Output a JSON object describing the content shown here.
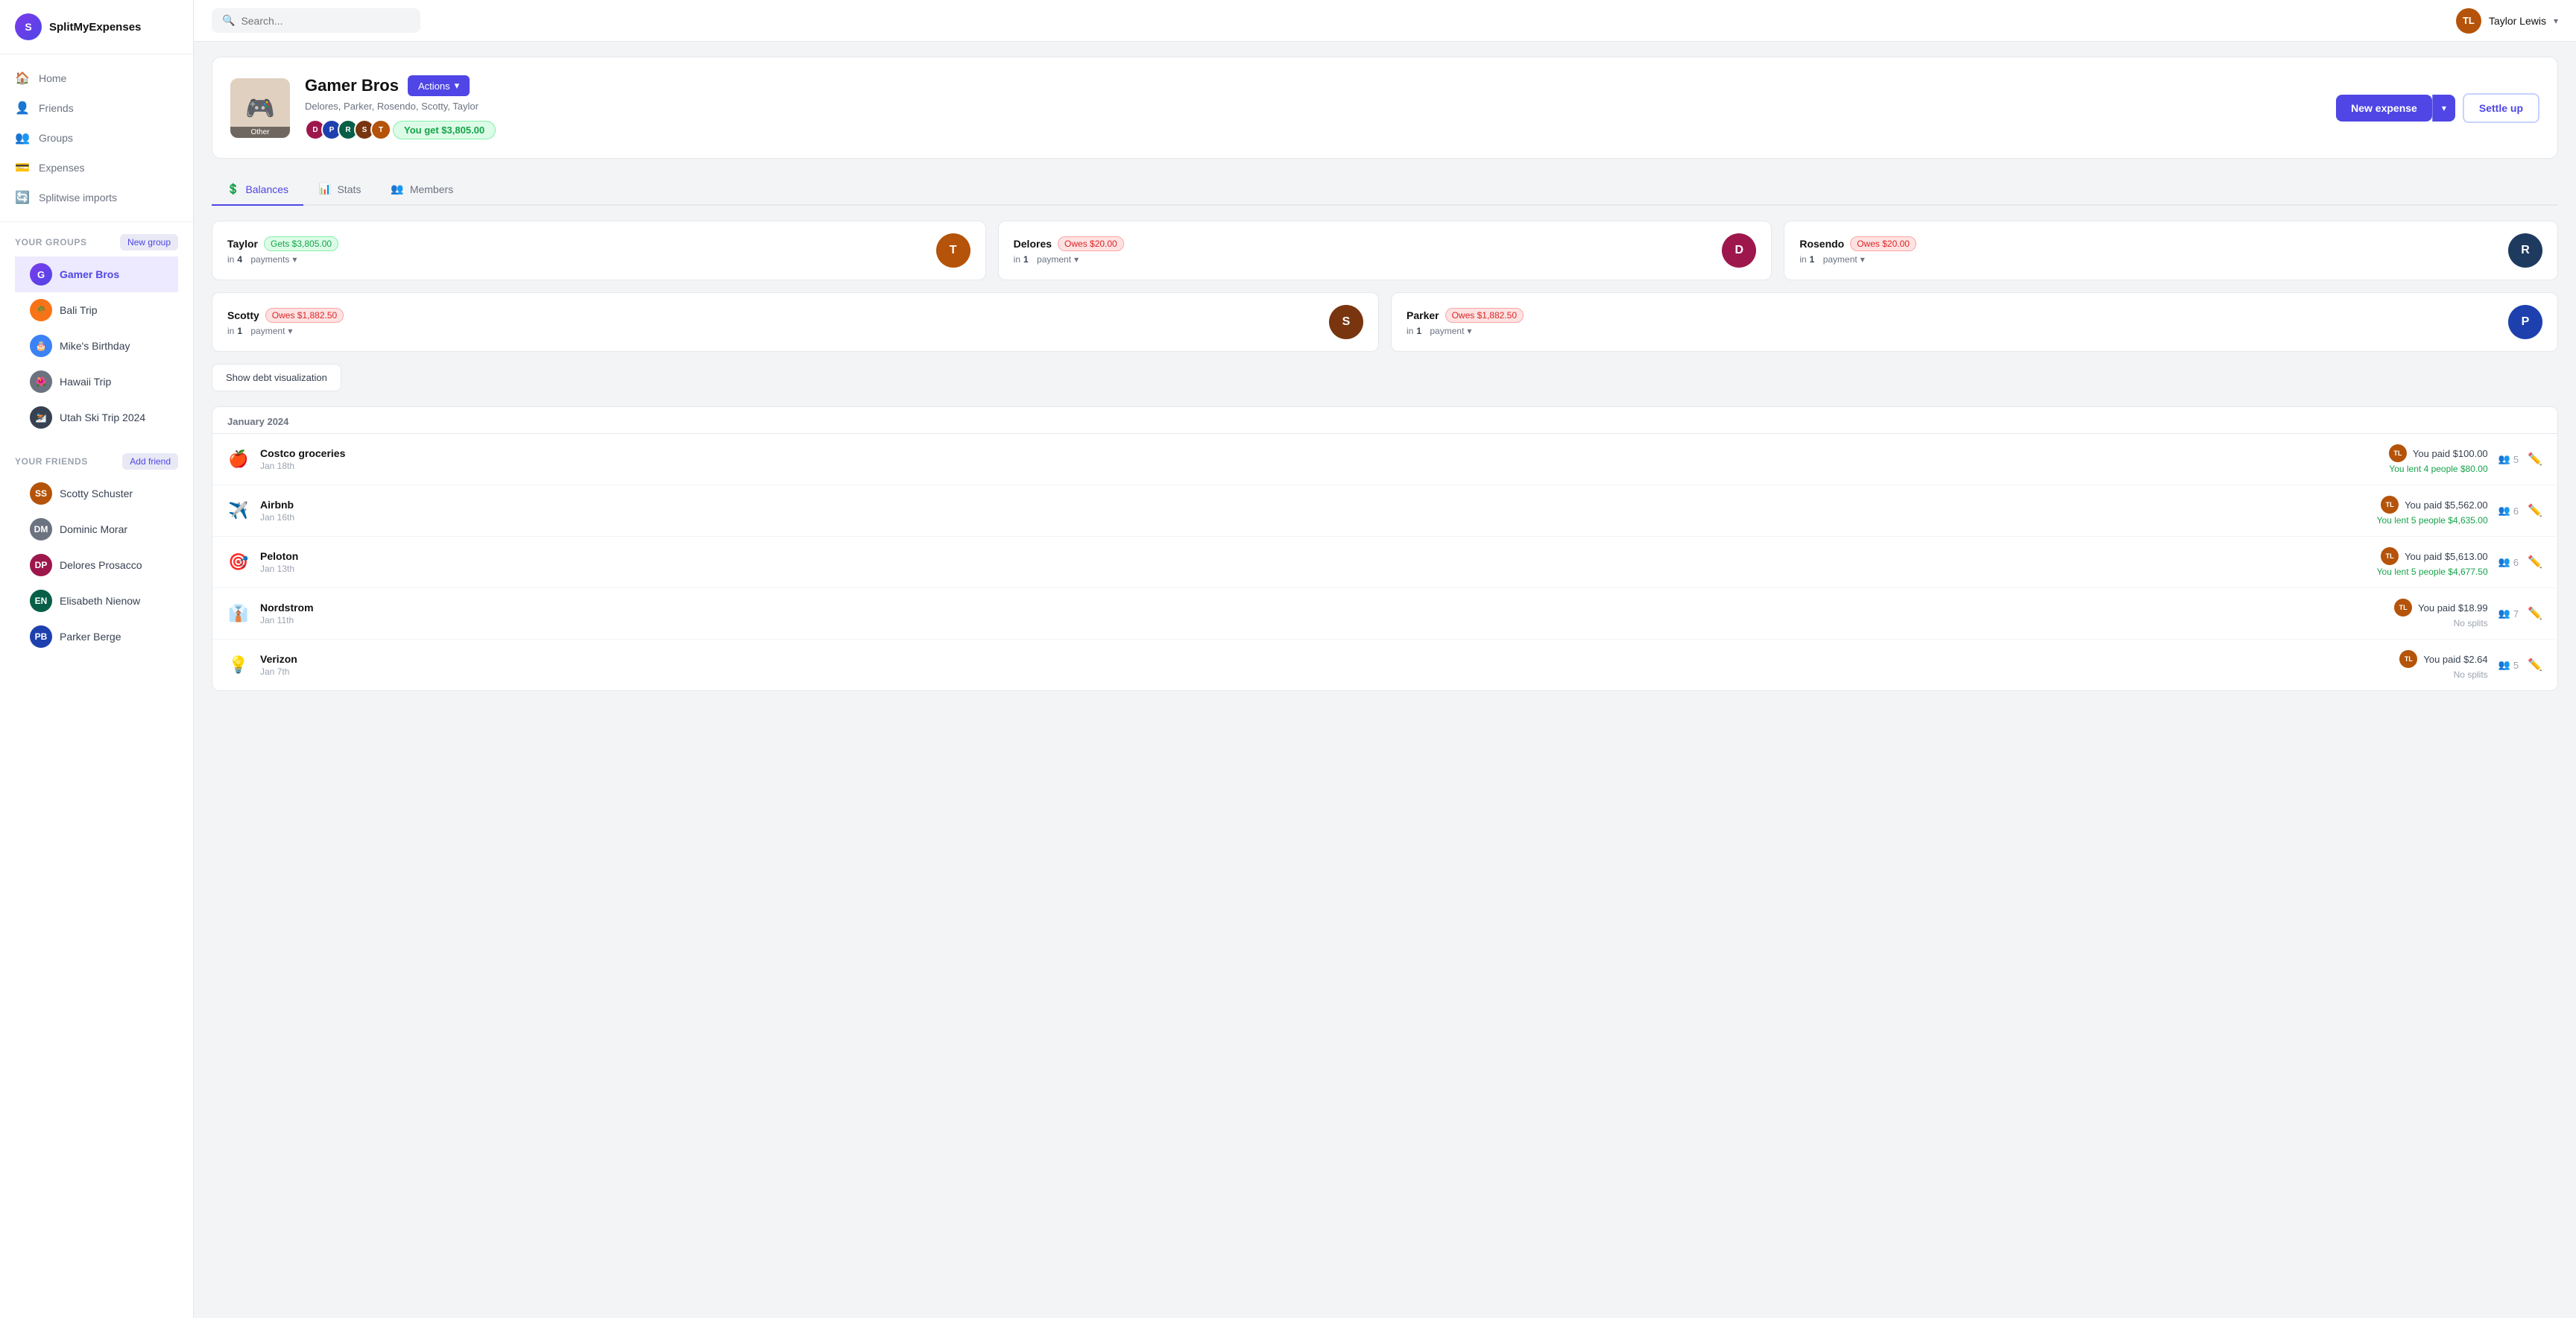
{
  "app": {
    "name": "SplitMyExpenses",
    "logo_letter": "S"
  },
  "topbar": {
    "search_placeholder": "Search...",
    "user_name": "Taylor Lewis",
    "user_initials": "TL"
  },
  "nav": [
    {
      "id": "home",
      "label": "Home",
      "icon": "🏠"
    },
    {
      "id": "friends",
      "label": "Friends",
      "icon": "👤"
    },
    {
      "id": "groups",
      "label": "Groups",
      "icon": "👥"
    },
    {
      "id": "expenses",
      "label": "Expenses",
      "icon": "💳"
    },
    {
      "id": "splitwise-imports",
      "label": "Splitwise imports",
      "icon": "🔄"
    }
  ],
  "sidebar": {
    "your_groups_label": "Your groups",
    "new_group_label": "New group",
    "your_friends_label": "Your friends",
    "add_friend_label": "Add friend",
    "groups": [
      {
        "id": "gamer-bros",
        "label": "Gamer Bros",
        "active": true,
        "color": "purple"
      },
      {
        "id": "bali-trip",
        "label": "Bali Trip",
        "color": "orange"
      },
      {
        "id": "mikes-birthday",
        "label": "Mike's Birthday",
        "color": "blue"
      },
      {
        "id": "hawaii-trip",
        "label": "Hawaii Trip",
        "color": "gray"
      },
      {
        "id": "utah-ski-trip",
        "label": "Utah Ski Trip 2024",
        "color": "dark"
      }
    ],
    "friends": [
      {
        "id": "scotty",
        "label": "Scotty Schuster",
        "initials": "SS",
        "color": "#b45309"
      },
      {
        "id": "dominic",
        "label": "Dominic Morar",
        "initials": "DM",
        "color": "#6b7280"
      },
      {
        "id": "delores",
        "label": "Delores Prosacco",
        "initials": "DP",
        "color": "#9d174d"
      },
      {
        "id": "elisabeth",
        "label": "Elisabeth Nienow",
        "initials": "EN",
        "color": "#065f46"
      },
      {
        "id": "parker",
        "label": "Parker Berge",
        "initials": "PB",
        "color": "#1e40af"
      }
    ]
  },
  "group": {
    "name": "Gamer Bros",
    "members_text": "Delores, Parker, Rosendo, Scotty, Taylor",
    "other_label": "Other",
    "balance_text": "You get $3,805.00",
    "actions_label": "Actions",
    "new_expense_label": "New expense",
    "settle_up_label": "Settle up"
  },
  "tabs": [
    {
      "id": "balances",
      "label": "Balances",
      "icon": "💲",
      "active": true
    },
    {
      "id": "stats",
      "label": "Stats",
      "icon": "📊",
      "active": false
    },
    {
      "id": "members",
      "label": "Members",
      "icon": "👥",
      "active": false
    }
  ],
  "balances": [
    {
      "name": "Taylor",
      "badge_type": "gets",
      "badge_text": "Gets $3,805.00",
      "payments_count": "4",
      "payments_label": "payments",
      "avatar_color": "#b45309"
    },
    {
      "name": "Delores",
      "badge_type": "owes",
      "badge_text": "Owes $20.00",
      "payments_count": "1",
      "payments_label": "payment",
      "avatar_color": "#9d174d"
    },
    {
      "name": "Rosendo",
      "badge_type": "owes",
      "badge_text": "Owes $20.00",
      "payments_count": "1",
      "payments_label": "payment",
      "avatar_color": "#1e3a5f"
    },
    {
      "name": "Scotty",
      "badge_type": "owes",
      "badge_text": "Owes $1,882.50",
      "payments_count": "1",
      "payments_label": "payment",
      "avatar_color": "#78350f"
    },
    {
      "name": "Parker",
      "badge_type": "owes",
      "badge_text": "Owes $1,882.50",
      "payments_count": "1",
      "payments_label": "payment",
      "avatar_color": "#1e40af"
    }
  ],
  "show_debt_btn": "Show debt visualization",
  "month_label": "January 2024",
  "expenses": [
    {
      "icon": "🍎",
      "name": "Costco groceries",
      "date": "Jan 18th",
      "paid": "You paid $100.00",
      "lent": "You lent 4 people $80.00",
      "people": "5",
      "has_splits": true
    },
    {
      "icon": "✈️",
      "name": "Airbnb",
      "date": "Jan 16th",
      "paid": "You paid $5,562.00",
      "lent": "You lent 5 people $4,635.00",
      "people": "6",
      "has_splits": true
    },
    {
      "icon": "🎯",
      "name": "Peloton",
      "date": "Jan 13th",
      "paid": "You paid $5,613.00",
      "lent": "You lent 5 people $4,677.50",
      "people": "6",
      "has_splits": true
    },
    {
      "icon": "👔",
      "name": "Nordstrom",
      "date": "Jan 11th",
      "paid": "You paid $18.99",
      "lent": null,
      "no_splits": "No splits",
      "people": "7",
      "has_splits": false
    },
    {
      "icon": "💡",
      "name": "Verizon",
      "date": "Jan 7th",
      "paid": "You paid $2.64",
      "lent": null,
      "no_splits": "No splits",
      "people": "5",
      "has_splits": false
    }
  ]
}
